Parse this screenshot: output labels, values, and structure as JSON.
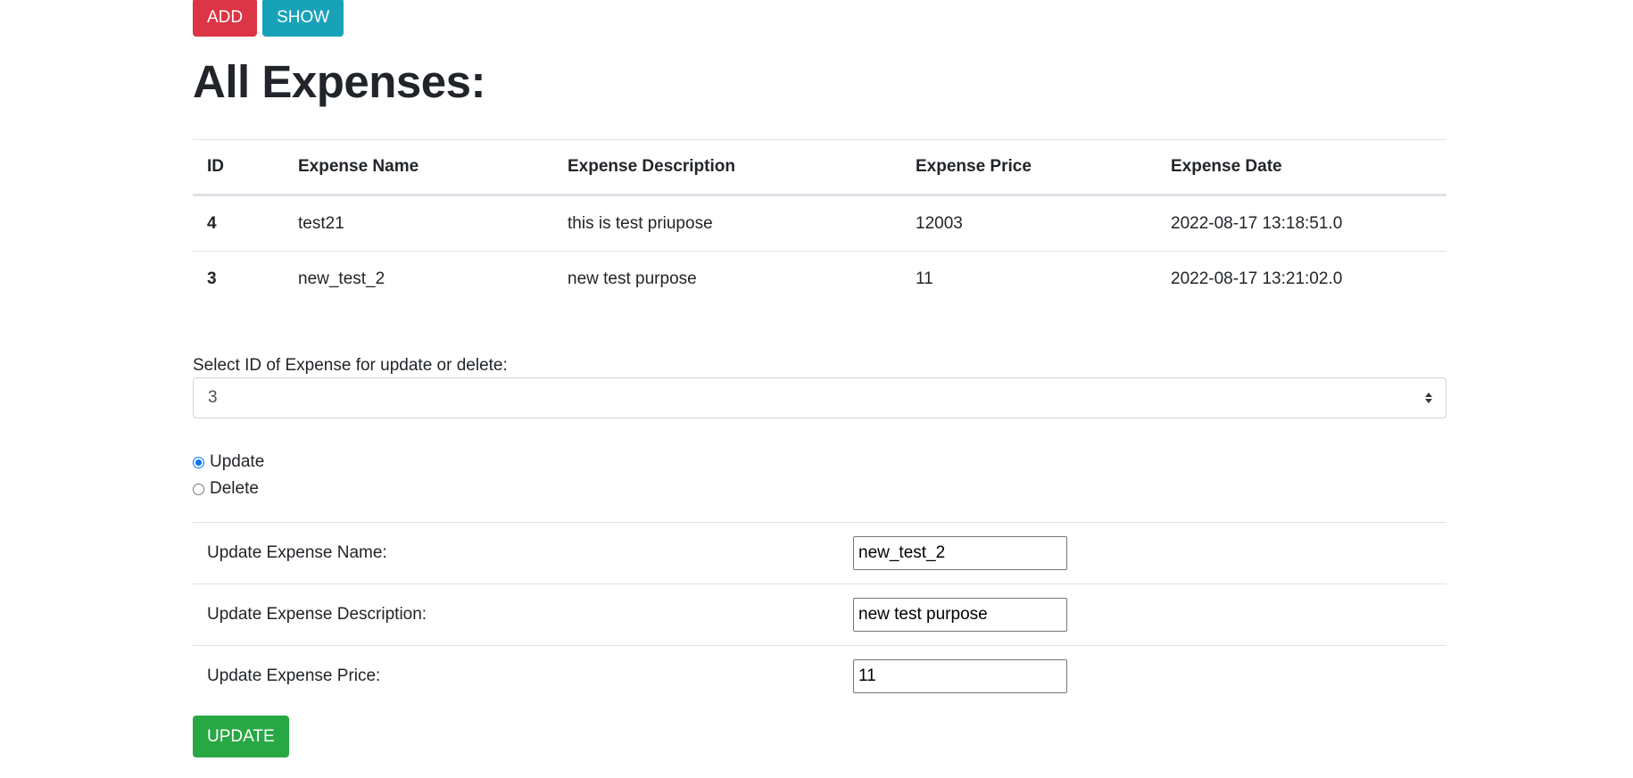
{
  "toolbar": {
    "add_label": "ADD",
    "show_label": "SHOW"
  },
  "page_title": "All Expenses:",
  "table": {
    "headers": [
      "ID",
      "Expense Name",
      "Expense Description",
      "Expense Price",
      "Expense Date"
    ],
    "rows": [
      [
        "4",
        "test21",
        "this is test priupose",
        "12003",
        "2022-08-17 13:18:51.0"
      ],
      [
        "3",
        "new_test_2",
        "new test purpose",
        "11",
        "2022-08-17 13:21:02.0"
      ]
    ]
  },
  "select": {
    "label": "Select ID of Expense for update or delete:",
    "value": "3",
    "icon": "sort-arrows-icon"
  },
  "radios": {
    "update_label": "Update",
    "delete_label": "Delete",
    "selected": "Update"
  },
  "form": {
    "name_label": "Update Expense Name:",
    "name_value": "new_test_2",
    "description_label": "Update Expense Description:",
    "description_value": "new test purpose",
    "price_label": "Update Expense Price:",
    "price_value": "11"
  },
  "update_button_label": "UPDATE",
  "colors": {
    "add": "#dc3545",
    "show": "#17a2b8",
    "update": "#28a745",
    "radio_checked": "#0075ff"
  }
}
